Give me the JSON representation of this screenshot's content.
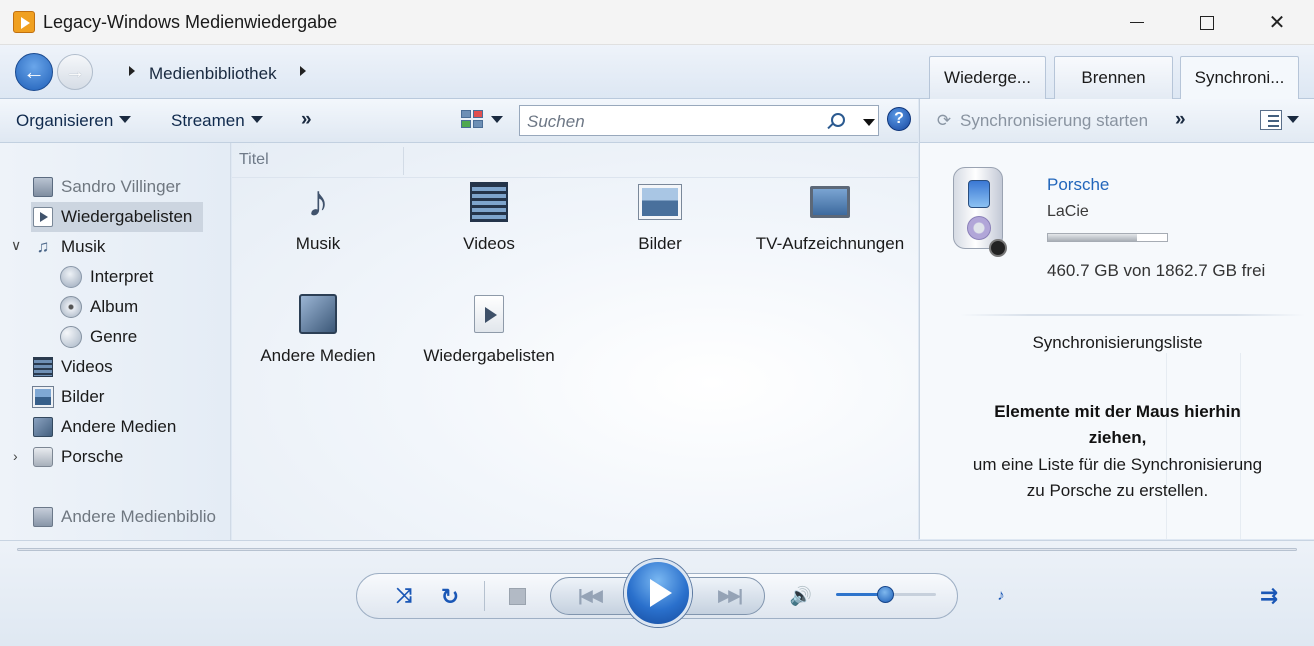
{
  "window": {
    "title": "Legacy-Windows Medienwiedergabe"
  },
  "nav": {
    "breadcrumb": "Medienbibliothek"
  },
  "tabs": [
    {
      "label": "Wiederge..."
    },
    {
      "label": "Brennen"
    },
    {
      "label": "Synchroni..."
    }
  ],
  "toolbar": {
    "organize": "Organisieren",
    "stream": "Streamen",
    "more": "»",
    "search_placeholder": "Suchen",
    "help": "?"
  },
  "sidebar": {
    "items": [
      {
        "label": "Sandro Villinger",
        "icon": "user-library-icon"
      },
      {
        "label": "Wiedergabelisten",
        "icon": "playlist-icon"
      },
      {
        "label": "Musik",
        "icon": "music-note-icon"
      },
      {
        "label": "Interpret",
        "icon": "artist-icon"
      },
      {
        "label": "Album",
        "icon": "album-icon"
      },
      {
        "label": "Genre",
        "icon": "genre-icon"
      },
      {
        "label": "Videos",
        "icon": "film-icon"
      },
      {
        "label": "Bilder",
        "icon": "picture-icon"
      },
      {
        "label": "Andere Medien",
        "icon": "other-media-icon"
      },
      {
        "label": "Porsche",
        "icon": "device-icon"
      },
      {
        "label": "Andere Medienbiblio",
        "icon": "other-library-icon"
      }
    ]
  },
  "content": {
    "column_header": "Titel",
    "tiles": [
      {
        "label": "Musik"
      },
      {
        "label": "Videos"
      },
      {
        "label": "Bilder"
      },
      {
        "label": "TV-Aufzeichnungen"
      },
      {
        "label": "Andere Medien"
      },
      {
        "label": "Wiedergabelisten"
      }
    ]
  },
  "sync_panel": {
    "start_label": "Synchronisierung starten",
    "more": "»",
    "device_name": "Porsche",
    "device_model": "LaCie",
    "capacity_used_fraction": 0.75,
    "free_space": "460.7 GB von 1862.7 GB frei",
    "list_title": "Synchronisierungsliste",
    "drag_hint_bold": "Elemente mit der Maus hierhin ziehen,",
    "drag_hint": "um eine Liste für die Synchronisierung zu Porsche zu erstellen."
  },
  "player": {
    "volume_level": 0.5
  }
}
